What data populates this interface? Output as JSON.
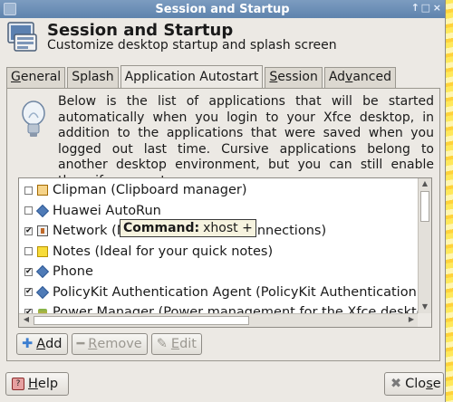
{
  "window": {
    "title": "Session and Startup",
    "controls": {
      "minimize": "↑",
      "maximize": "□",
      "close": "×"
    }
  },
  "header": {
    "title": "Session and Startup",
    "subtitle": "Customize desktop startup and splash screen",
    "icon": "session-startup-icon"
  },
  "tabs": [
    {
      "label": "General",
      "mnemonic": "G",
      "rest": "eneral",
      "active": false
    },
    {
      "label": "Splash",
      "active": false
    },
    {
      "label": "Application Autostart",
      "active": true
    },
    {
      "label": "Session",
      "mnemonic": "S",
      "rest": "ession",
      "active": false
    },
    {
      "label": "Advanced",
      "pre": "Ad",
      "mnemonic": "v",
      "rest": "anced",
      "active": false
    }
  ],
  "info_text": "Below is the list of applications that will be started automatically when you login to your Xfce desktop, in addition to the applications that were saved when you logged out last time. Cursive applications belong to another desktop environment, but you can still enable them if you want.",
  "autostart": {
    "items": [
      {
        "label": "Clipman (Clipboard manager)",
        "checked": false,
        "icon": "clipboard-icon"
      },
      {
        "label": "Huawei  AutoRun",
        "checked": false,
        "icon": "diamond-icon"
      },
      {
        "label": "Network (Manage your network connections)",
        "visible_label": "Network (M",
        "tail": "connections)",
        "checked": true,
        "icon": "network-icon"
      },
      {
        "label": "Notes (Ideal for your quick notes)",
        "checked": false,
        "icon": "notes-icon"
      },
      {
        "label": "Phone",
        "checked": true,
        "icon": "diamond-icon"
      },
      {
        "label": "PolicyKit Authentication Agent (PolicyKit Authentication Agent)",
        "checked": true,
        "icon": "diamond-icon"
      },
      {
        "label": "Power Manager (Power management for the Xfce desktop)",
        "checked": true,
        "icon": "power-icon"
      }
    ],
    "tooltip": {
      "key": "Command:",
      "value": "xhost +"
    }
  },
  "buttons": {
    "add": {
      "label": "Add",
      "mnemonic": "A",
      "rest": "dd",
      "enabled": true
    },
    "remove": {
      "label": "Remove",
      "mnemonic": "R",
      "rest": "emove",
      "enabled": false
    },
    "edit": {
      "label": "Edit",
      "mnemonic": "E",
      "rest": "dit",
      "enabled": false
    }
  },
  "footer": {
    "help": {
      "label": "Help",
      "mnemonic": "H",
      "rest": "elp"
    },
    "close": {
      "label": "Close",
      "pre": "",
      "head": "Clo",
      "mnemonic": "s",
      "rest": "e"
    }
  },
  "colors": {
    "titlebar": "#5e83ad",
    "window_bg": "#ece9e4",
    "backdrop": "#ffe85a"
  }
}
